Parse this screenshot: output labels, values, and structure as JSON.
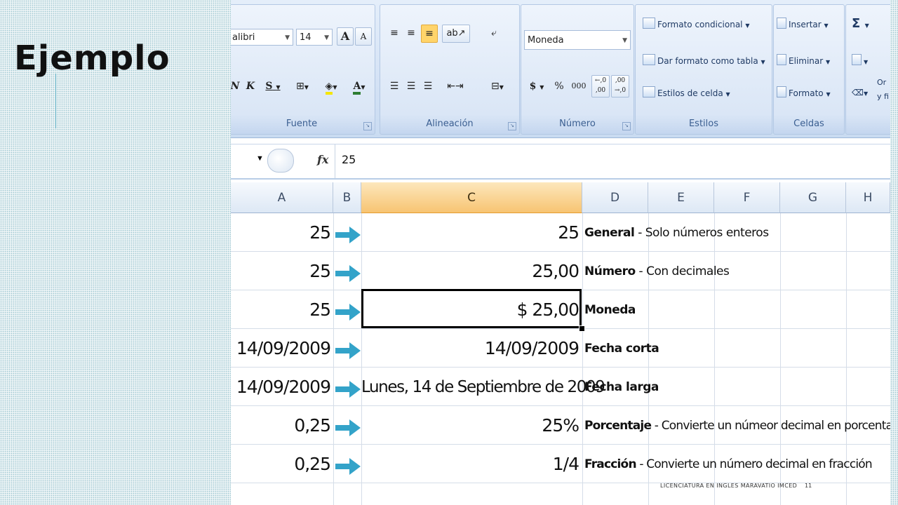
{
  "slide": {
    "title": "Ejemplo"
  },
  "ribbon": {
    "font_group": {
      "font_name": "alibri",
      "font_size": "14",
      "grow": "A",
      "shrink": "A",
      "bold": "N",
      "italic": "K",
      "underline": "S",
      "label": "Fuente"
    },
    "align_group": {
      "label": "Alineación"
    },
    "number_group": {
      "format": "Moneda",
      "currency": "$",
      "percent": "%",
      "thousands": "000",
      "inc_dec": "←,0 ,00",
      "dec_dec": ",00 →,0",
      "label": "Número"
    },
    "styles_group": {
      "conditional": "Formato condicional",
      "as_table": "Dar formato como tabla",
      "cell_styles": "Estilos de celda",
      "label": "Estilos"
    },
    "cells_group": {
      "insert": "Insertar",
      "delete": "Eliminar",
      "format": "Formato",
      "label": "Celdas"
    },
    "edit_group": {
      "sum": "Σ",
      "sort": "Or",
      "sort2": "y fi"
    }
  },
  "formula_bar": {
    "fx": "fx",
    "value": "25"
  },
  "columns": [
    "A",
    "B",
    "C",
    "D",
    "E",
    "F",
    "G",
    "H"
  ],
  "rows": [
    {
      "a": "25",
      "c": "25",
      "desc_bold": "General",
      "desc_rest": " - Solo números enteros"
    },
    {
      "a": "25",
      "c": "25,00",
      "desc_bold": "Número",
      "desc_rest": " - Con decimales"
    },
    {
      "a": "25",
      "c": "$ 25,00",
      "desc_bold": "Moneda",
      "desc_rest": ""
    },
    {
      "a": "14/09/2009",
      "c": "14/09/2009",
      "desc_bold": "Fecha corta",
      "desc_rest": ""
    },
    {
      "a": "14/09/2009",
      "c": "Lunes, 14 de Septiembre de 2009",
      "desc_bold": "Fecha larga",
      "desc_rest": ""
    },
    {
      "a": "0,25",
      "c": "25%",
      "desc_bold": "Porcentaje",
      "desc_rest": " - Convierte un númeor decimal en porcentaje"
    },
    {
      "a": "0,25",
      "c": "1/4",
      "desc_bold": "Fracción",
      "desc_rest": " - Convierte un número decimal en fracción"
    }
  ],
  "footer": {
    "text": "LICENCIATURA EN INGLES MARAVATIO IMCED",
    "page": "11"
  },
  "colors": {
    "arrow": "#33a3c9",
    "selected_header": "#f7c472"
  }
}
